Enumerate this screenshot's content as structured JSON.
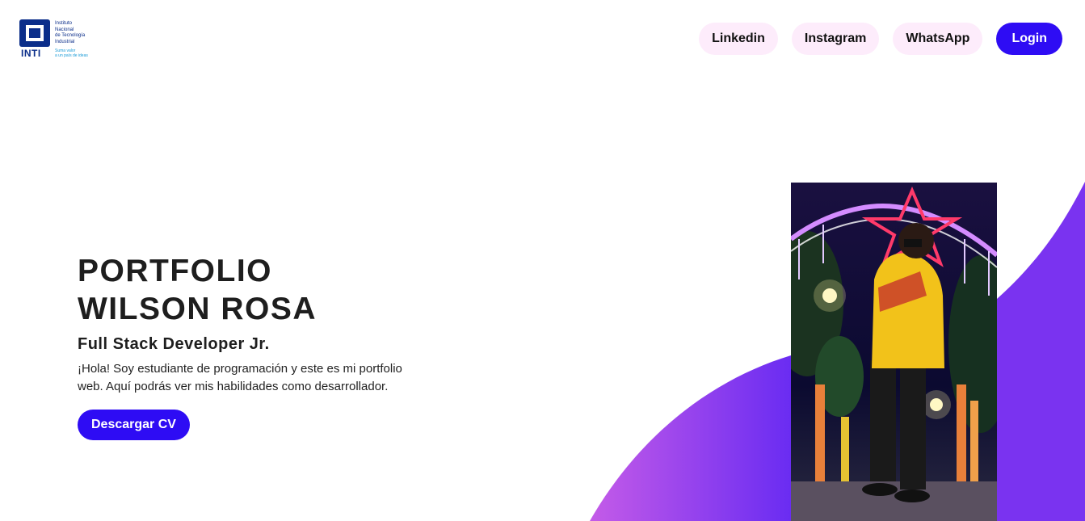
{
  "logo": {
    "name_lines": [
      "Instituto",
      "Nacional",
      "de Tecnología",
      "Industrial"
    ],
    "acronym": "INTI",
    "tagline_lines": [
      "Suma valor",
      "a un país de ideas"
    ]
  },
  "nav": {
    "links": [
      {
        "label": "Linkedin"
      },
      {
        "label": "Instagram"
      },
      {
        "label": "WhatsApp"
      }
    ],
    "login_label": "Login"
  },
  "hero": {
    "title_line1": "PORTFOLIO",
    "title_line2": "WILSON ROSA",
    "subtitle": "Full Stack Developer Jr.",
    "description": "¡Hola! Soy estudiante de programación y este es mi portfolio web. Aquí podrás ver mis habilidades como desarrollador.",
    "cta_label": "Descargar CV"
  },
  "colors": {
    "accent": "#2e0cf4",
    "nav_pill": "#fdecfb",
    "wave_start": "#c45be8",
    "wave_end": "#6a2cf2"
  }
}
